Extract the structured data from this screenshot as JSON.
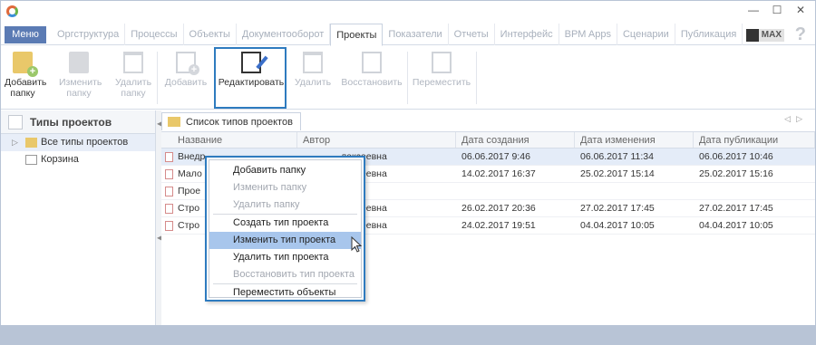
{
  "window": {
    "controls": [
      "—",
      "☐",
      "✕"
    ]
  },
  "menubar": {
    "menu_label": "Меню",
    "tabs": [
      "Оргструктура",
      "Процессы",
      "Объекты",
      "Документооборот",
      "Проекты",
      "Показатели",
      "Отчеты",
      "Интерфейс",
      "BPM Apps",
      "Сценарии",
      "Публикация"
    ],
    "active_tab": "Проекты",
    "max_label": "MAX",
    "help": "?"
  },
  "ribbon": {
    "add_folder": "Добавить\nпапку",
    "edit_folder": "Изменить\nпапку",
    "delete_folder": "Удалить\nпапку",
    "add": "Добавить",
    "edit": "Редактировать",
    "delete": "Удалить",
    "restore": "Восстановить",
    "move": "Переместить"
  },
  "left": {
    "title": "Типы проектов",
    "tree": [
      {
        "label": "Все типы проектов",
        "selected": true
      },
      {
        "label": "Корзина",
        "selected": false
      }
    ]
  },
  "doc_tab": "Список типов проектов",
  "table": {
    "headers": [
      "Название",
      "Автор",
      "Дата создания",
      "Дата изменения",
      "Дата публикации"
    ],
    "rows": [
      [
        "Внедр",
        "лексеевна",
        "06.06.2017 9:46",
        "06.06.2017 11:34",
        "06.06.2017 10:46"
      ],
      [
        "Мало",
        "лексеевна",
        "14.02.2017 16:37",
        "25.02.2017 15:14",
        "25.02.2017 15:16"
      ],
      [
        "Прое",
        "",
        "",
        "",
        ""
      ],
      [
        "Стро",
        "лексеевна",
        "26.02.2017 20:36",
        "27.02.2017 17:45",
        "27.02.2017 17:45"
      ],
      [
        "Стро",
        "лексеевна",
        "24.02.2017 19:51",
        "04.04.2017 10:05",
        "04.04.2017 10:05"
      ]
    ]
  },
  "context_menu": {
    "items": [
      {
        "label": "Добавить папку",
        "enabled": true
      },
      {
        "label": "Изменить папку",
        "enabled": false
      },
      {
        "label": "Удалить папку",
        "enabled": false
      },
      {
        "label": "Создать тип проекта",
        "enabled": true
      },
      {
        "label": "Изменить тип проекта",
        "enabled": true,
        "highlighted": true
      },
      {
        "label": "Удалить тип проекта",
        "enabled": true
      },
      {
        "label": "Восстановить тип проекта",
        "enabled": false
      },
      {
        "label": "Переместить объекты",
        "enabled": true
      }
    ]
  }
}
